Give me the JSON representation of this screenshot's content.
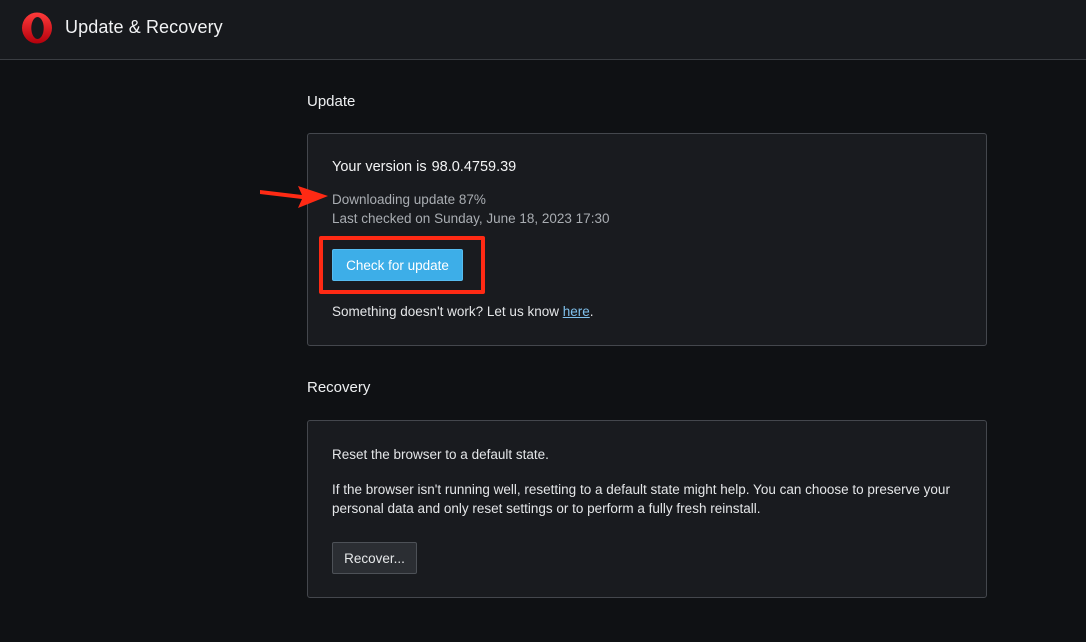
{
  "header": {
    "title": "Update & Recovery",
    "logo_icon": "opera-logo-icon"
  },
  "update": {
    "section_title": "Update",
    "version_label": "Your version is",
    "version_value": "98.0.4759.39",
    "status": "Downloading update 87%",
    "progress_percent": 87,
    "last_checked": "Last checked on Sunday, June 18, 2023 17:30",
    "check_button": "Check for update",
    "feedback_prefix": "Something doesn't work? Let us know ",
    "feedback_link": "here",
    "feedback_suffix": "."
  },
  "recovery": {
    "section_title": "Recovery",
    "reset_text": "Reset the browser to a default state.",
    "description": "If the browser isn't running well, resetting to a default state might help. You can choose to preserve your personal data and only reset settings or to perform a fully fresh reinstall.",
    "recover_button": "Recover..."
  },
  "colors": {
    "accent": "#3daee8",
    "annotation": "#ff2a14",
    "link": "#7fc0ec"
  }
}
